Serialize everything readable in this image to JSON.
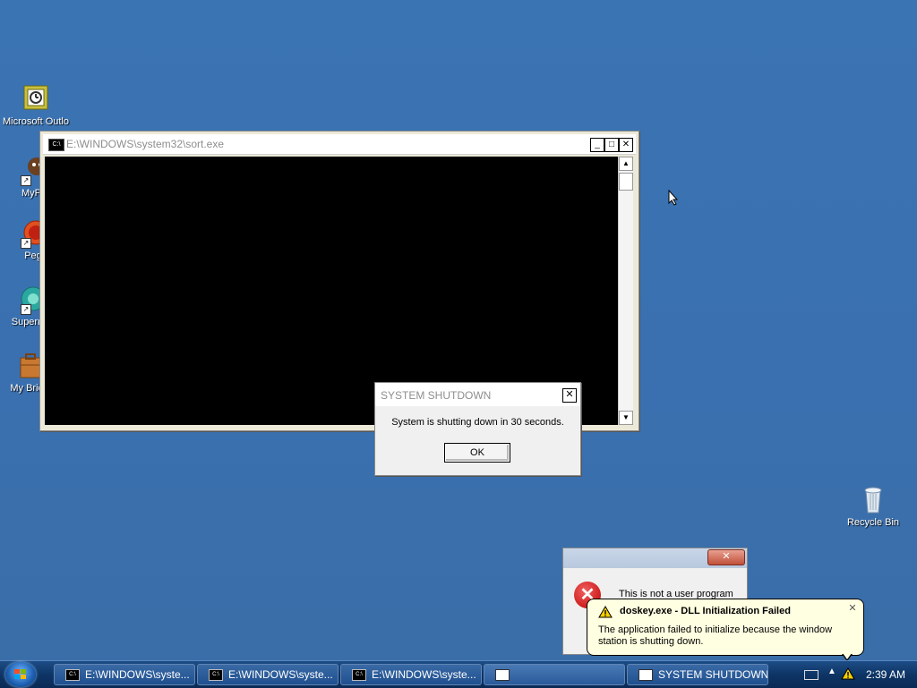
{
  "desktop": {
    "icons": [
      {
        "label": "Microsoft Outlo",
        "icon": "outlook-icon"
      },
      {
        "label": "MyPa",
        "icon": "mypal-icon"
      },
      {
        "label": "Peg",
        "icon": "pegasus-icon"
      },
      {
        "label": "Superm",
        "icon": "superm-icon"
      },
      {
        "label": "My Brie",
        "icon": "briefcase-icon"
      },
      {
        "label": "Recycle Bin",
        "icon": "recycle-bin-icon"
      }
    ]
  },
  "console_window": {
    "title": "E:\\WINDOWS\\system32\\sort.exe",
    "icon_text": "C:\\",
    "minimize": "_",
    "maximize": "□",
    "close": "✕",
    "scroll_up": "▲",
    "scroll_down": "▼"
  },
  "shutdown_dialog": {
    "title": "SYSTEM SHUTDOWN",
    "message": "System is shutting down in 30 seconds.",
    "ok_label": "OK",
    "close": "✕"
  },
  "error_window": {
    "close": "✕",
    "message": "This is not a user program"
  },
  "balloon": {
    "title": "doskey.exe - DLL Initialization Failed",
    "text": "The application failed to initialize because the window station is shutting down.",
    "close": "✕"
  },
  "taskbar": {
    "items": [
      {
        "label": "E:\\WINDOWS\\syste..."
      },
      {
        "label": "E:\\WINDOWS\\syste..."
      },
      {
        "label": "E:\\WINDOWS\\syste..."
      },
      {
        "label": ""
      },
      {
        "label": "SYSTEM SHUTDOWN"
      }
    ],
    "tray_arrow": "▲",
    "clock": "2:39 AM"
  },
  "colors": {
    "desktop": "#3a6ea5",
    "taskbar": "#0e3566",
    "balloon": "#ffffe1"
  }
}
